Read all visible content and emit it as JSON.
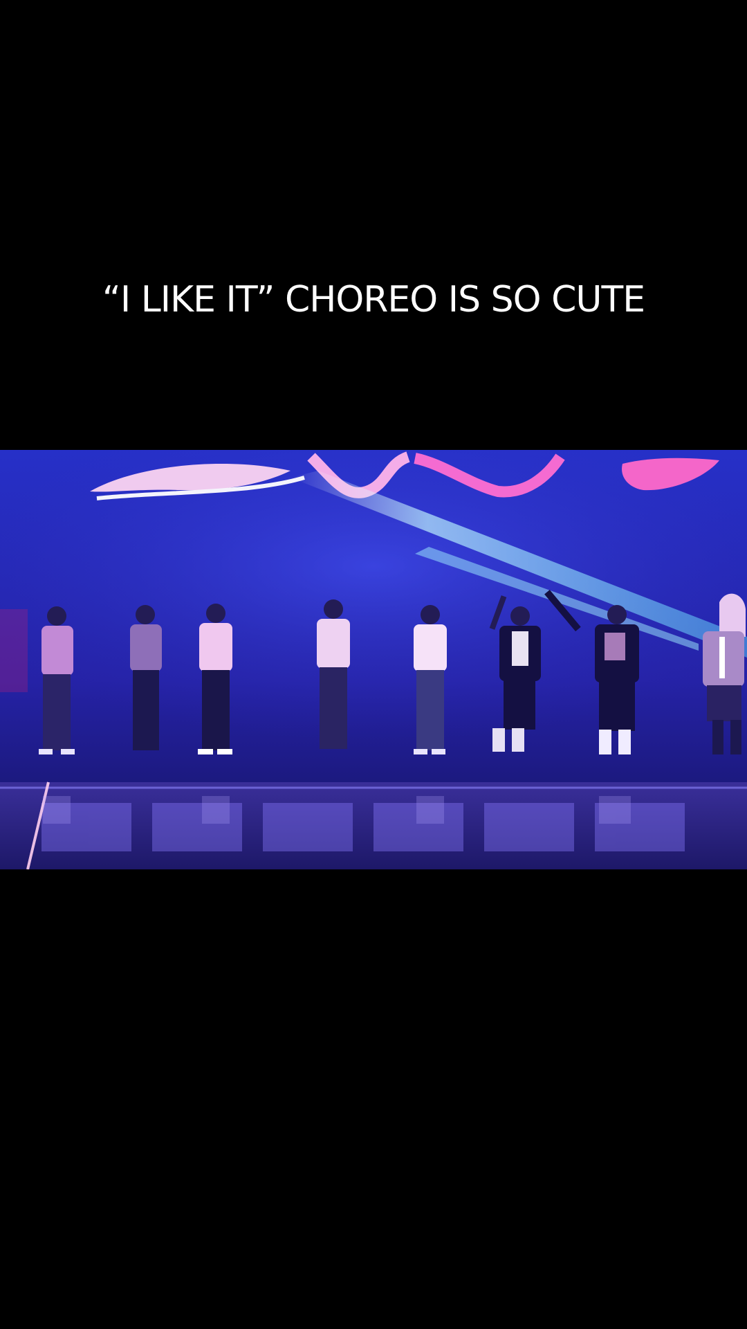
{
  "overlay": {
    "caption_text": "“I LIKE IT” CHOREO IS SO CUTE"
  },
  "video": {
    "scene": "concert-stage-performance",
    "performer_count": 8,
    "colors": {
      "background": "#000000",
      "stage_blue": "#2a2bb8",
      "stage_deep": "#15157a",
      "sign_pink": "#ff7ad9",
      "beam_cyan": "#7ee8ff",
      "caption_text": "#ffffff"
    }
  }
}
